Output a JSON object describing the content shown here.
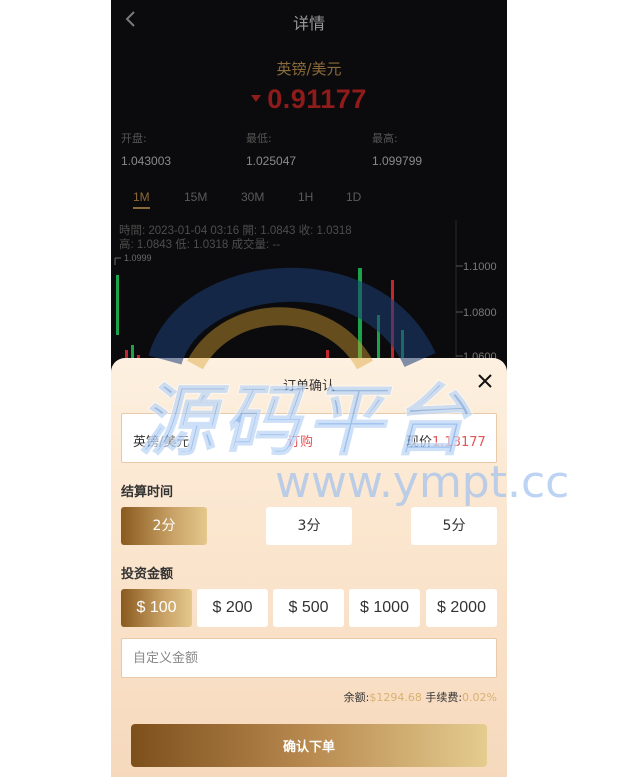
{
  "header": {
    "title": "详情"
  },
  "pair": {
    "name": "英镑/美元",
    "price": "0.91177"
  },
  "stats": [
    {
      "label": "开盘:",
      "value": "1.043003"
    },
    {
      "label": "最低:",
      "value": "1.025047"
    },
    {
      "label": "最高:",
      "value": "1.099799"
    }
  ],
  "tabs": [
    "1M",
    "15M",
    "30M",
    "1H",
    "1D"
  ],
  "ohlc": {
    "line1": "時間: 2023-01-04 03:16   開: 1.0843   收: 1.0318",
    "line2": "高: 1.0843   低: 1.0318   成交量: --"
  },
  "chart_axis": {
    "max_label": "1.0999",
    "ticks": [
      "1.1000",
      "1.0800",
      "1.0600"
    ]
  },
  "colors": {
    "up": "#1aa34a",
    "down": "#c1272d",
    "gold": "#d7b271",
    "accent_red": "#e25555"
  },
  "sheet": {
    "title": "订单确认",
    "pair": "英镑/美元",
    "direction": "订购",
    "current_label": "现价",
    "current_value": "1.13177",
    "settle_title": "结算时间",
    "settle_options": [
      "2分",
      "3分",
      "5分"
    ],
    "invest_title": "投资金额",
    "amounts": [
      "$ 100",
      "$ 200",
      "$ 500",
      "$ 1000",
      "$ 2000"
    ],
    "custom_placeholder": "自定义金额",
    "balance_label": "余额:",
    "balance_value": "$1294.68",
    "fee_label": "手续费:",
    "fee_value": "0.02%",
    "confirm": "确认下单"
  },
  "watermark": {
    "text": "源码平台",
    "url": "www.ympt.cc"
  }
}
